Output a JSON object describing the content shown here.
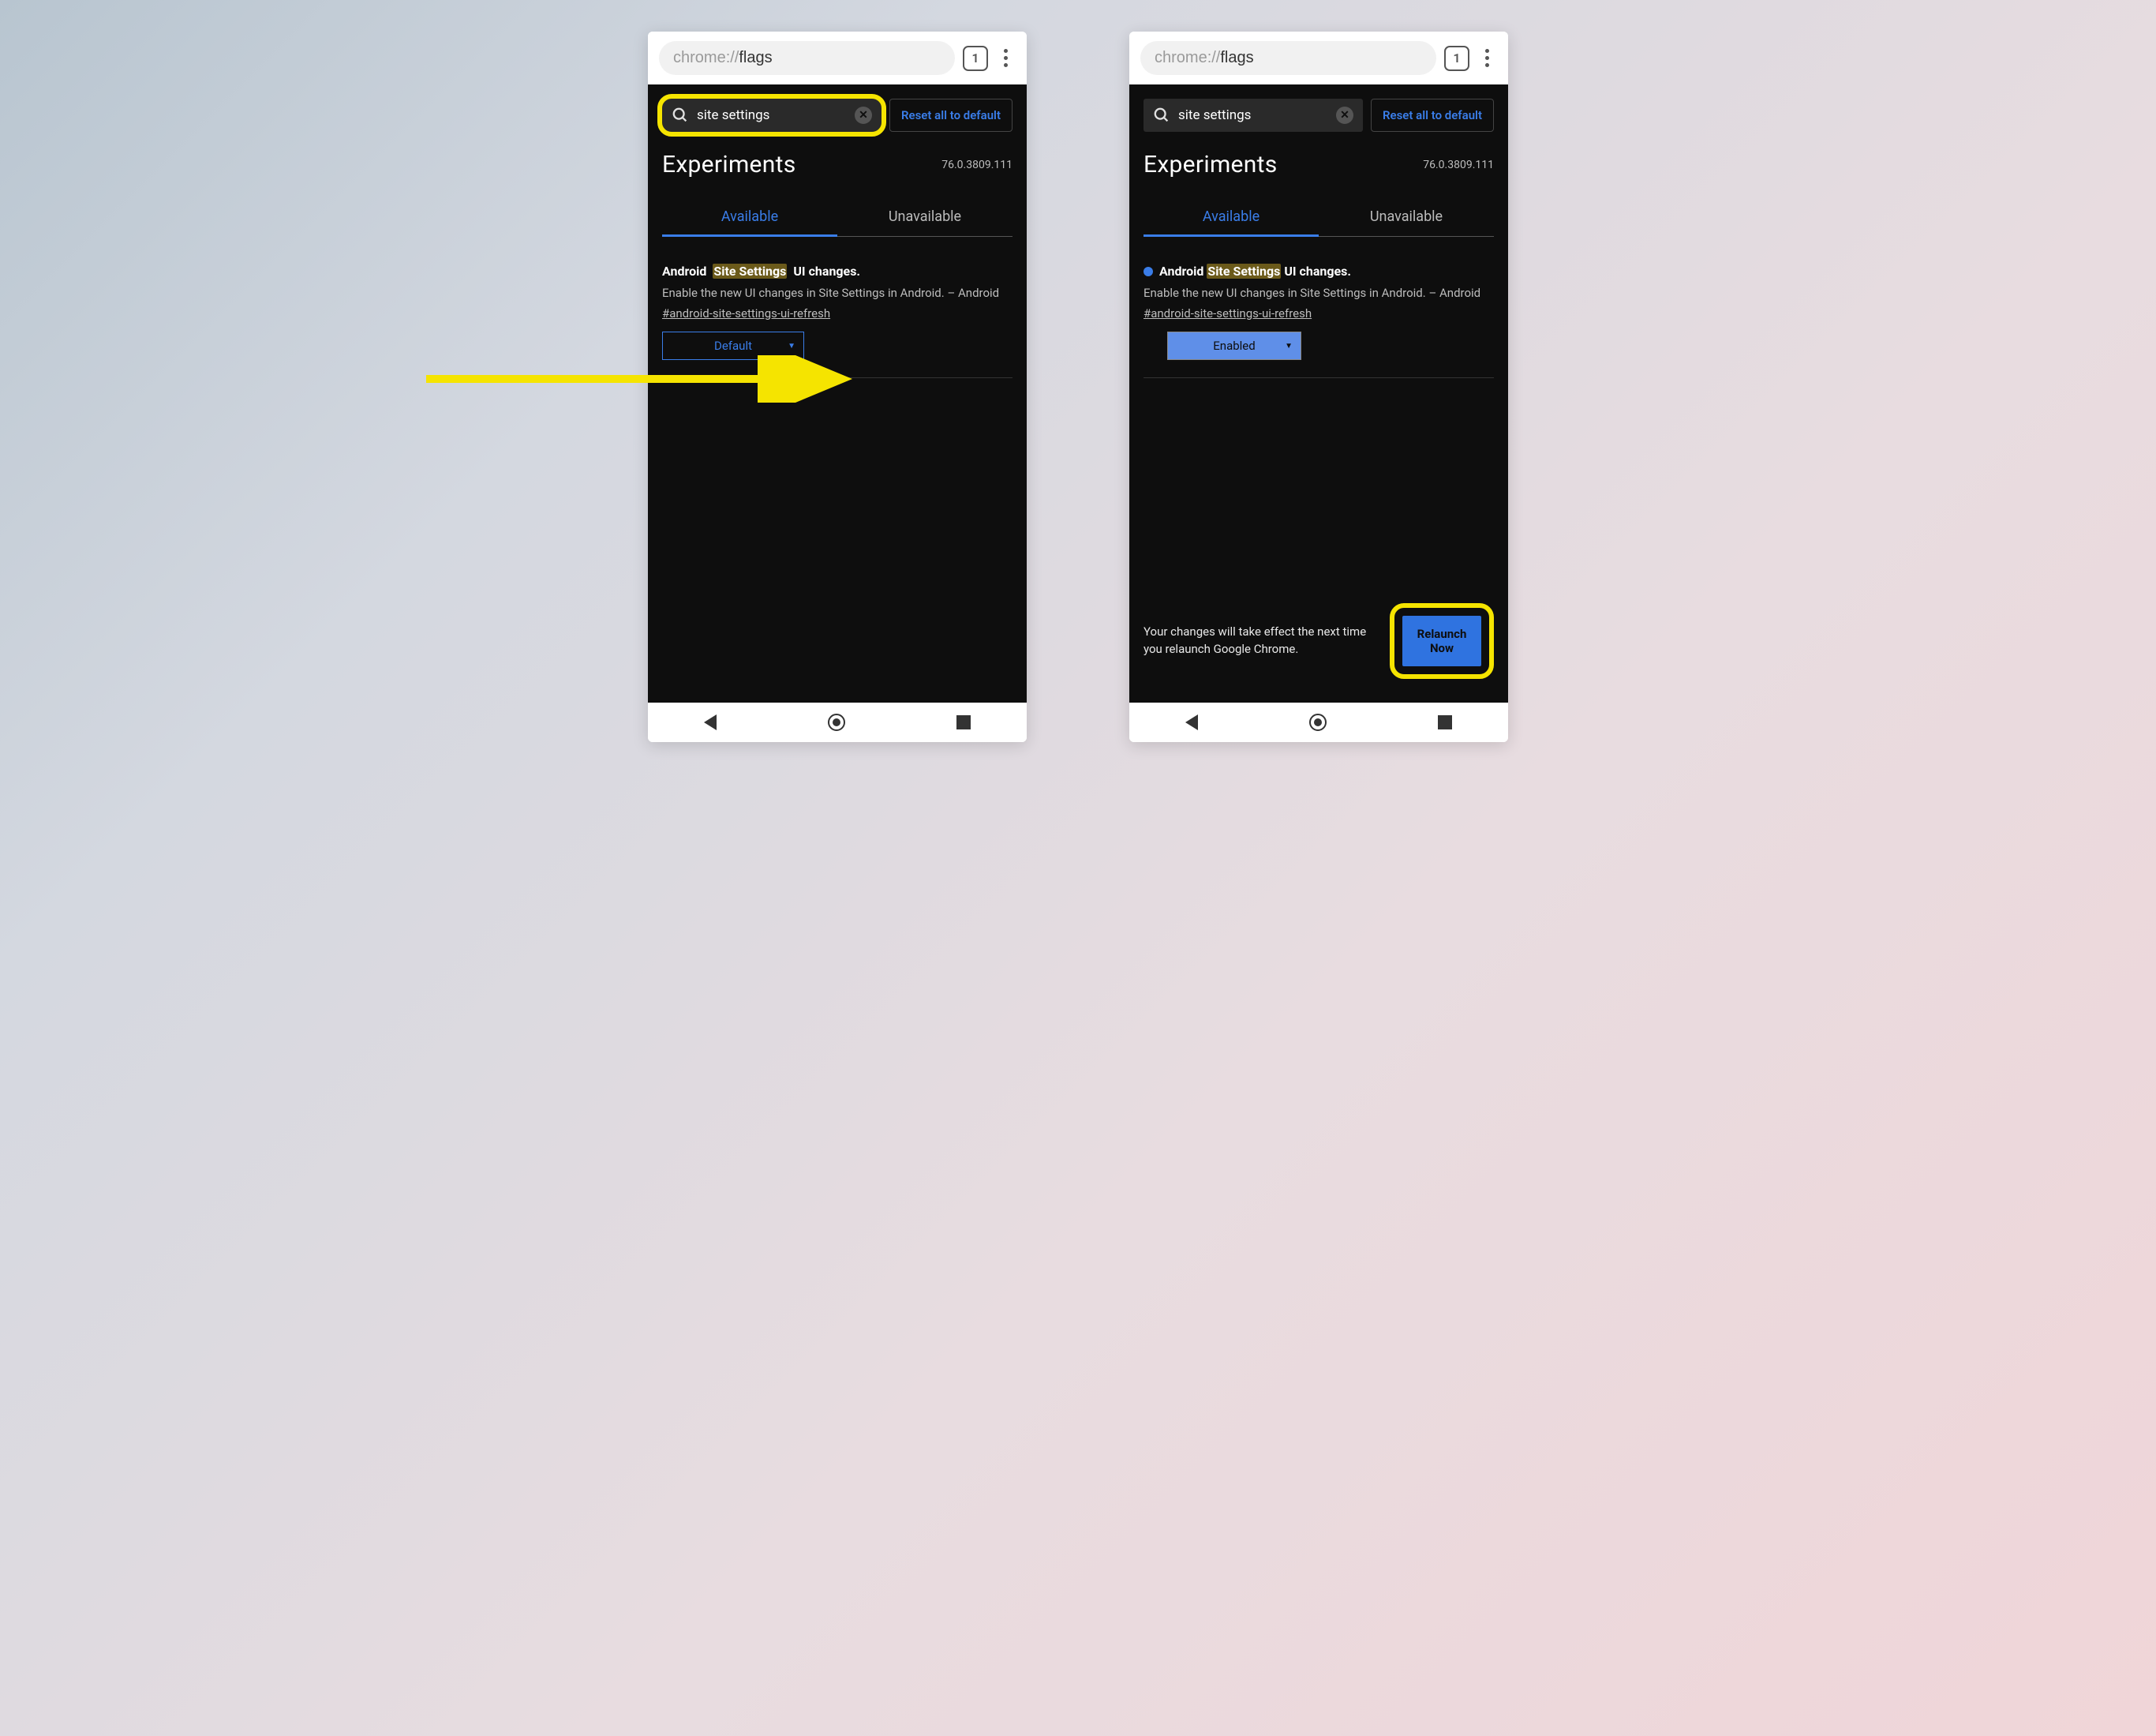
{
  "url": {
    "prefix": "chrome://",
    "path": "flags"
  },
  "tab_count": "1",
  "search_value": "site settings",
  "reset_label": "Reset all to default",
  "page_title": "Experiments",
  "version": "76.0.3809.111",
  "tabs": {
    "available": "Available",
    "unavailable": "Unavailable"
  },
  "flag": {
    "title_pre": "Android ",
    "title_hl": "Site Settings",
    "title_post": " UI changes.",
    "desc": "Enable the new UI changes in Site Settings in Android. – Android",
    "hash": "#android-site-settings-ui-refresh"
  },
  "dropdown_default": "Default",
  "dropdown_enabled": "Enabled",
  "footer_text": "Your changes will take effect the next time you relaunch Google Chrome.",
  "relaunch_label": "Relaunch Now"
}
